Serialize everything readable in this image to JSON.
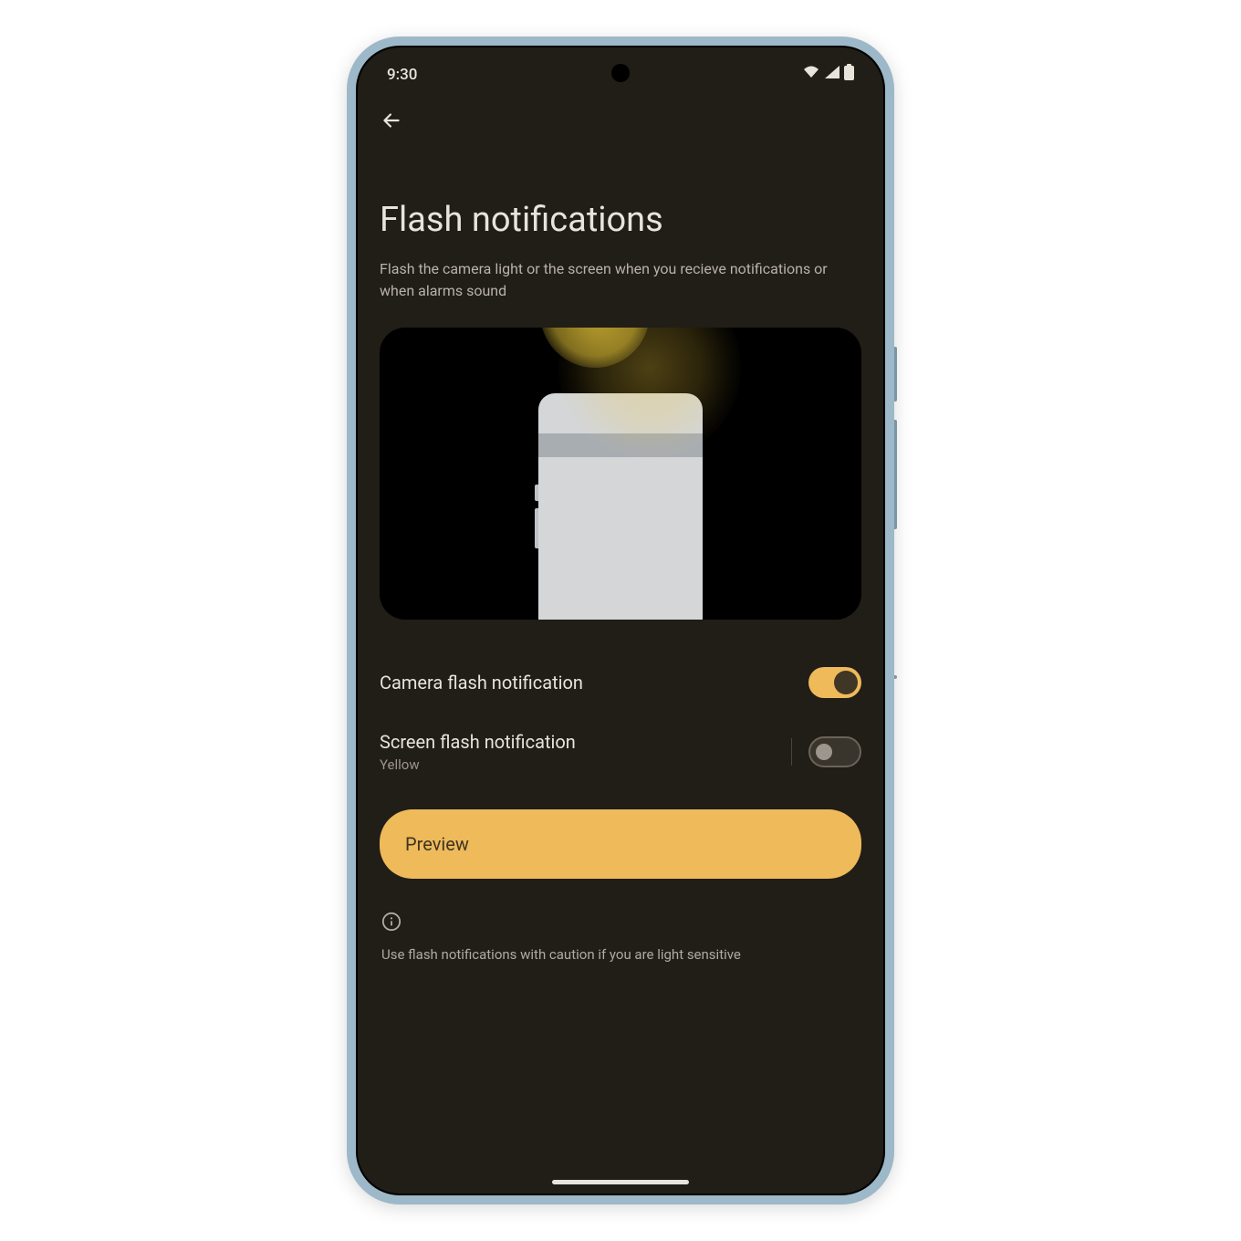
{
  "status": {
    "time": "9:30"
  },
  "page": {
    "title": "Flash notifications",
    "subtitle": "Flash the camera light or the screen when you recieve notifications or when alarms sound"
  },
  "settings": {
    "camera_flash": {
      "label": "Camera flash notification",
      "enabled": true
    },
    "screen_flash": {
      "label": "Screen flash notification",
      "sub": "Yellow",
      "enabled": false
    }
  },
  "preview": {
    "label": "Preview"
  },
  "info": {
    "text": "Use flash notifications with caution if you are light sensitive"
  },
  "colors": {
    "accent": "#eeba5a",
    "bg": "#211d17"
  }
}
